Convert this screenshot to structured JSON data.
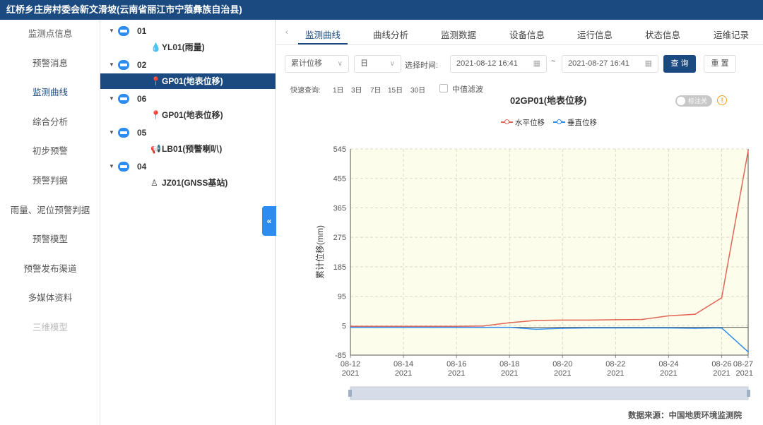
{
  "app": {
    "title": "红桥乡庄房村委会新文滑坡(云南省丽江市宁蒗彝族自治县)"
  },
  "nav": {
    "items": [
      {
        "label": "监测点信息",
        "state": "normal"
      },
      {
        "label": "预警消息",
        "state": "normal"
      },
      {
        "label": "监测曲线",
        "state": "active"
      },
      {
        "label": "综合分析",
        "state": "normal"
      },
      {
        "label": "初步预警",
        "state": "normal"
      },
      {
        "label": "预警判据",
        "state": "normal"
      },
      {
        "label": "雨量、泥位预警判据",
        "state": "normal"
      },
      {
        "label": "预警模型",
        "state": "normal"
      },
      {
        "label": "预警发布渠道",
        "state": "normal"
      },
      {
        "label": "多媒体资料",
        "state": "normal"
      },
      {
        "label": "三维模型",
        "state": "disabled"
      }
    ]
  },
  "tree": {
    "rows": [
      {
        "kind": "station",
        "label": "01"
      },
      {
        "kind": "child",
        "icon": "raindrop-icon",
        "glyph": "💧",
        "label": "YL01(雨量)"
      },
      {
        "kind": "station",
        "label": "02"
      },
      {
        "kind": "child",
        "icon": "location-pin-icon",
        "glyph": "📍",
        "label": "GP01(地表位移)",
        "selected": true
      },
      {
        "kind": "station",
        "label": "06"
      },
      {
        "kind": "child",
        "icon": "location-pin-icon",
        "glyph": "📍",
        "label": "GP01(地表位移)"
      },
      {
        "kind": "station",
        "label": "05"
      },
      {
        "kind": "child",
        "icon": "megaphone-icon",
        "glyph": "📢",
        "label": "LB01(预警喇叭)"
      },
      {
        "kind": "station",
        "label": "04"
      },
      {
        "kind": "child",
        "icon": "gnss-station-icon",
        "glyph": "♙",
        "label": "JZ01(GNSS基站)"
      }
    ],
    "collapse_glyph": "«"
  },
  "tabs": {
    "prev_glyph": "‹",
    "items": [
      "监测曲线",
      "曲线分析",
      "监测数据",
      "设备信息",
      "运行信息",
      "状态信息",
      "运维记录"
    ],
    "active_index": 0
  },
  "filters": {
    "metric_value": "累计位移",
    "interval_value": "日",
    "time_label": "选择时间:",
    "start_time": "2021-08-12 16:41",
    "end_time": "2021-08-27 16:41",
    "range_sep": "~",
    "query_label": "查 询",
    "reset_label": "重 置",
    "quick_label": "快速查询:",
    "quick_options": [
      "1日",
      "3日",
      "7日",
      "15日",
      "30日"
    ],
    "median_filter_label": "中值滤波"
  },
  "chart_header": {
    "title": "02GP01(地表位移)",
    "toggle_label": "标注关",
    "info_glyph": "!"
  },
  "chart_data": {
    "type": "line",
    "title": "02GP01(地表位移)",
    "ylabel": "累计位移(mm)",
    "xlabel": "",
    "ylim": [
      -85,
      545
    ],
    "yticks": [
      -85,
      5,
      95,
      185,
      275,
      365,
      455,
      545
    ],
    "xticks": [
      {
        "day": 12,
        "label": "08-12",
        "year": "2021"
      },
      {
        "day": 14,
        "label": "08-14",
        "year": "2021"
      },
      {
        "day": 16,
        "label": "08-16",
        "year": "2021"
      },
      {
        "day": 18,
        "label": "08-18",
        "year": "2021"
      },
      {
        "day": 20,
        "label": "08-20",
        "year": "2021"
      },
      {
        "day": 22,
        "label": "08-22",
        "year": "2021"
      },
      {
        "day": 24,
        "label": "08-24",
        "year": "2021"
      },
      {
        "day": 26,
        "label": "08-26",
        "year": "2021"
      },
      {
        "day": 27,
        "label": "08-27",
        "year": "2021"
      }
    ],
    "grid": true,
    "legend_position": "top-center",
    "background": "#fdfdec",
    "series": [
      {
        "name": "水平位移",
        "color": "#e06656",
        "points": [
          [
            12,
            3
          ],
          [
            13,
            3
          ],
          [
            14,
            3
          ],
          [
            15,
            3
          ],
          [
            16,
            3
          ],
          [
            17,
            4
          ],
          [
            18,
            14
          ],
          [
            19,
            21
          ],
          [
            20,
            22
          ],
          [
            21,
            22
          ],
          [
            22,
            23
          ],
          [
            23,
            24
          ],
          [
            24,
            35
          ],
          [
            25,
            40
          ],
          [
            26,
            90
          ],
          [
            27,
            540
          ]
        ]
      },
      {
        "name": "垂直位移",
        "color": "#2c8cf0",
        "points": [
          [
            12,
            0
          ],
          [
            13,
            0
          ],
          [
            14,
            0
          ],
          [
            15,
            0
          ],
          [
            16,
            0
          ],
          [
            17,
            0
          ],
          [
            18,
            0
          ],
          [
            19,
            -6
          ],
          [
            20,
            -3
          ],
          [
            21,
            -2
          ],
          [
            22,
            -2
          ],
          [
            23,
            -2
          ],
          [
            24,
            -2
          ],
          [
            25,
            -3
          ],
          [
            26,
            -2
          ],
          [
            27,
            -75
          ]
        ]
      }
    ]
  },
  "footer": {
    "source": "数据来源：中国地质环境监测院"
  }
}
